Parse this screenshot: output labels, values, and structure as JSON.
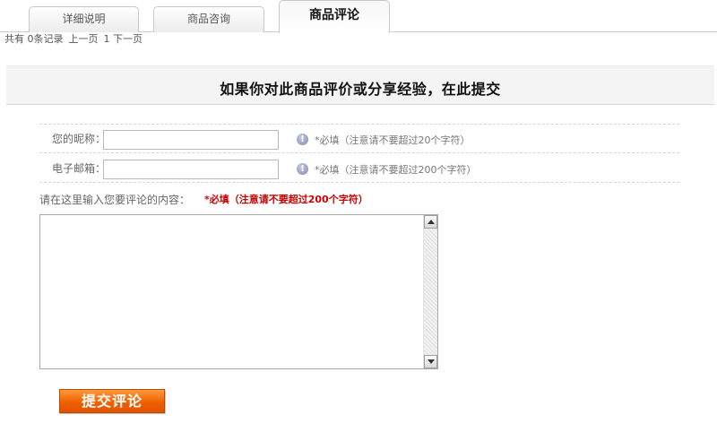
{
  "tabs": [
    {
      "label": "详细说明",
      "active": false
    },
    {
      "label": "商品咨询",
      "active": false
    },
    {
      "label": "商品评论",
      "active": true
    }
  ],
  "pager": {
    "total_text": "共有 0条记录",
    "prev": "上一页",
    "page_info": "1 下一页"
  },
  "heading": "如果你对此商品评价或分享经验，在此提交",
  "form": {
    "nickname_label": "您的昵称：",
    "nickname_value": "",
    "nickname_hint": "*必填（注意请不要超过20个字符）",
    "email_label": "电子邮箱：",
    "email_value": "",
    "email_hint": "*必填（注意请不要超过200个字符）",
    "content_label": "请在这里输入您要评论的内容：",
    "content_hint": "*必填（注意请不要超过200个字符）",
    "content_value": ""
  },
  "submit_label": "提交评论",
  "colors": {
    "submit_orange": "#f06000",
    "required_red": "#cc0000",
    "band_bg": "#f4f4f4"
  },
  "icons": {
    "hint_icon": "info-icon",
    "scroll_up": "arrow-up-icon",
    "scroll_down": "arrow-down-icon"
  }
}
